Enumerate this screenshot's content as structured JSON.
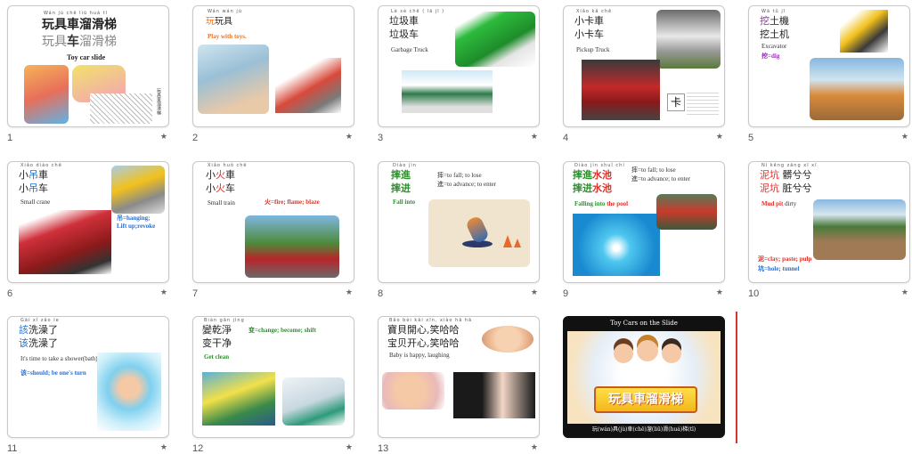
{
  "star": "★",
  "slides": [
    {
      "num": "1",
      "pinyin": "Wán  jù   chē  liū   huá   tī",
      "trad": "玩具車溜滑梯",
      "simp_a": "玩具",
      "simp_b": "车",
      "simp_c": "溜滑梯",
      "eng": "Toy car slide",
      "vertical": "玩具車溜滑梯"
    },
    {
      "num": "2",
      "pinyin": "Wán  wán  jù",
      "char_red": "玩",
      "rest": "玩具",
      "eng": "Play with toys."
    },
    {
      "num": "3",
      "pinyin": "Lè   sè   chē  ( lā  jī )",
      "trad": "垃圾車",
      "simp": "垃圾车",
      "eng": "Garbage Truck"
    },
    {
      "num": "4",
      "pinyin": "Xiǎo  kǎ  chē",
      "trad": "小卡車",
      "simp": "小卡车",
      "eng": "Pickup Truck",
      "card_char": "卡"
    },
    {
      "num": "5",
      "pinyin": "Wā   tǔ   jī",
      "char_red": "挖",
      "trad_rest": "土機",
      "simp": "挖土机",
      "eng": "Excavator",
      "gloss": "挖=dig"
    },
    {
      "num": "6",
      "pinyin": "Xiǎo  diào  chē",
      "char_a": "小",
      "char_red": "吊",
      "char_b": "車",
      "simp_a": "小",
      "simp_red": "吊",
      "simp_b": "车",
      "eng": "Small crane",
      "gloss1": "吊=hanging;",
      "gloss2": "Lift up;revoke"
    },
    {
      "num": "7",
      "pinyin": "Xiǎo  huǒ  chē",
      "char_a": "小",
      "char_red": "火",
      "char_b": "車",
      "simp_a": "小",
      "simp_red": "火",
      "simp_b": "车",
      "eng": "Small train",
      "gloss": "火=fire; flame; blaze"
    },
    {
      "num": "8",
      "pinyin": "Diào  jìn",
      "trad": "摔進",
      "simp": "摔进",
      "eng": "Fall into",
      "gloss1": "摔=to fall; to lose",
      "gloss2": "進=to advance; to enter"
    },
    {
      "num": "9",
      "pinyin": "Diào  jìn  shuǐ  chí",
      "trad_g": "摔進",
      "trad_r": "水池",
      "simp_g": "摔进",
      "simp_r": "水池",
      "eng_g": "Falling into",
      "eng_r": "the pool",
      "gloss1": "摔=to fall; to lose",
      "gloss2": "進=to advance; to enter"
    },
    {
      "num": "10",
      "pinyin": "Ní   kēng  zāng  xī   xī",
      "trad_r": "泥坑",
      "trad_rest": "髒兮兮",
      "simp_r": "泥坑",
      "simp_rest": "脏兮兮",
      "eng_r": "Mud pit",
      "eng_rest": " dirty",
      "gloss1": "泥=clay; paste; pulp",
      "gloss2": "坑=hole; tunnel"
    },
    {
      "num": "11",
      "pinyin": "Gāi   xǐ   zǎo  le",
      "trad_r": "該",
      "trad_rest": "洗澡了",
      "simp_r": "该",
      "simp_rest": "洗澡了",
      "eng": "It's time to take a shower(bath)",
      "gloss": "该=should; be one's turn"
    },
    {
      "num": "12",
      "pinyin": "Biàn gān  jìng",
      "trad": "變乾淨",
      "simp": "变干净",
      "eng": "Get clean",
      "gloss": "变=change; become; shift"
    },
    {
      "num": "13",
      "pinyin": "Bǎo  bèi  kāi  xīn,  xiào  hā  hā",
      "trad": "寶貝開心,笑哈哈",
      "simp": "宝贝开心,笑哈哈",
      "eng": "Baby is happy, laughing"
    },
    {
      "num": "",
      "title": "Toy Cars on the Slide",
      "banner": "玩具車溜滑梯",
      "caption": "玩(wán)具(jù)車(chē)溜(liū)滑(huá)梯(tī)"
    }
  ],
  "colors": {
    "red": "#d9342b",
    "green": "#2f8f2f",
    "orange": "#e2762b",
    "purple": "#9b2fb5",
    "blue": "#2a6fd1",
    "divider": "#d9342b"
  }
}
